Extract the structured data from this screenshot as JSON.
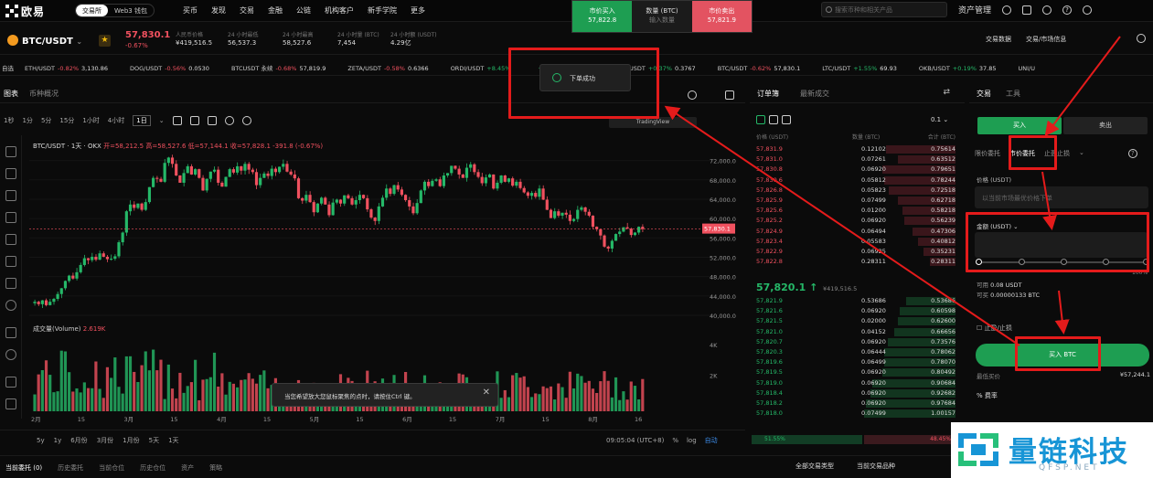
{
  "brand": {
    "name": "欧易",
    "mode_tabs": [
      "交易所",
      "Web3 钱包"
    ]
  },
  "nav": [
    "买币",
    "发现",
    "交易",
    "金融",
    "公链",
    "机构客户",
    "新手学院",
    "更多"
  ],
  "search": {
    "placeholder": "搜索币种和相关产品"
  },
  "top_right": {
    "asset_label": "资产管理"
  },
  "quick_order": {
    "buy": {
      "label": "市价买入",
      "value": "57,822.8"
    },
    "mid": {
      "label": "数量 (BTC)",
      "value": "输入数量"
    },
    "sell": {
      "label": "市价卖出",
      "value": "57,821.9"
    }
  },
  "pair": {
    "symbol": "BTC/USDT",
    "last": "57,830.1",
    "change": "-0.67%"
  },
  "stats": [
    {
      "label": "人民币价格",
      "value": "¥419,516.5"
    },
    {
      "label": "24 小时最低",
      "value": "56,537.3"
    },
    {
      "label": "24 小时最高",
      "value": "58,527.6"
    },
    {
      "label": "24 小时量 (BTC)",
      "value": "7,454"
    },
    {
      "label": "24 小时额 (USDT)",
      "value": "4.29亿"
    }
  ],
  "top_tools": [
    "交易数据",
    "交易/市场信息"
  ],
  "strip": [
    {
      "name": "ETH/USDT",
      "chg": "-0.82%",
      "price": "3,130.86",
      "dir": "dn"
    },
    {
      "name": "DOG/USDT",
      "chg": "-0.56%",
      "price": "0.0530",
      "dir": "dn"
    },
    {
      "name": "BTCUSDT 永续",
      "chg": "-0.68%",
      "price": "57,819.9",
      "dir": "dn"
    },
    {
      "name": "ZETA/USDT",
      "chg": "-0.58%",
      "price": "0.6366",
      "dir": "dn"
    },
    {
      "name": "ORDI/USDT",
      "chg": "+8.45%",
      "price": "",
      "dir": "up"
    },
    {
      "name": "",
      "chg": "+1.37%",
      "price": "0.00623",
      "dir": "up"
    },
    {
      "name": "LUNA/USDT",
      "chg": "+0.37%",
      "price": "0.3767",
      "dir": "up"
    },
    {
      "name": "BTC/USDT",
      "chg": "-0.62%",
      "price": "57,830.1",
      "dir": "dn"
    },
    {
      "name": "LTC/USDT",
      "chg": "+1.55%",
      "price": "69.93",
      "dir": "up"
    },
    {
      "name": "OKB/USDT",
      "chg": "+0.19%",
      "price": "37.85",
      "dir": "up"
    },
    {
      "name": "UNI/U",
      "chg": "",
      "price": "",
      "dir": "up"
    }
  ],
  "toast": {
    "text": "下单成功"
  },
  "chart_tabs": [
    "图表",
    "币种概况"
  ],
  "timeframes": [
    "1秒",
    "1分",
    "5分",
    "15分",
    "1小时",
    "4小时",
    "1日"
  ],
  "selected_tf": "1日",
  "tv_badge": "TradingView",
  "chart_title": "BTC/USDT · 1天 · OKX",
  "ohlc": "开=58,212.5 高=58,527.6 低=57,144.1 收=57,828.1 -391.8 (-0.67%)",
  "volume_title": {
    "label": "成交量(Volume)",
    "value": "2.619K"
  },
  "tooltip": {
    "text": "当您希望放大您鼠标聚焦的点时，请按住Ctrl 键。",
    "close": "✕"
  },
  "axis_bottom": {
    "ranges": [
      "5y",
      "1y",
      "6月份",
      "3月份",
      "1月份",
      "5天",
      "1天"
    ],
    "time": "09:05:04 (UTC+8)",
    "pct": "%",
    "log": "log",
    "auto": "自动"
  },
  "chart_data": {
    "type": "candlestick",
    "x_ticks": [
      "2月",
      "15",
      "3月",
      "15",
      "4月",
      "15",
      "5月",
      "15",
      "6月",
      "15",
      "7月",
      "15",
      "8月",
      "16"
    ],
    "y_ticks": [
      "72,000.0",
      "68,000.0",
      "64,000.0",
      "60,000.0",
      "56,000.0",
      "52,000.0",
      "48,000.0",
      "44,000.0",
      "40,000.0"
    ],
    "ylim": [
      40000,
      74000
    ],
    "last_price": "57,830.1",
    "vol_ticks": [
      "4K",
      "2K"
    ],
    "close": [
      42800,
      42300,
      43100,
      42100,
      42800,
      43400,
      44400,
      45600,
      47100,
      48200,
      47600,
      48900,
      50400,
      51800,
      51400,
      52100,
      51500,
      52800,
      52100,
      51600,
      51700,
      52200,
      55100,
      57100,
      61500,
      62900,
      62200,
      63100,
      61800,
      63400,
      66500,
      68400,
      68200,
      67600,
      71500,
      72600,
      71300,
      68900,
      67400,
      69400,
      70800,
      69100,
      70200,
      68400,
      65800,
      68200,
      69700,
      70100,
      67400,
      66600,
      68600,
      70200,
      69500,
      70800,
      69900,
      71300,
      70100,
      69600,
      66900,
      68400,
      69300,
      68800,
      70300,
      69600,
      70700,
      71300,
      69700,
      69100,
      68300,
      64200,
      63700,
      64900,
      63400,
      61300,
      63100,
      64300,
      62900,
      60700,
      63300,
      63900,
      63100,
      64800,
      64200,
      62900,
      63800,
      64900,
      64200,
      61900,
      60200,
      59500,
      62500,
      64300,
      66200,
      65100,
      66900,
      66000,
      64900,
      63800,
      62500,
      61100,
      63200,
      65800,
      67600,
      66700,
      67800,
      68100,
      66700,
      68900,
      69400,
      70900,
      70300,
      69100,
      68400,
      70500,
      71200,
      69600,
      68600,
      67300,
      68500,
      69100,
      66200,
      67400,
      68900,
      67600,
      68300,
      66800,
      67600,
      66300,
      65400,
      64700,
      65300,
      64500,
      66200,
      63900,
      61800,
      60100,
      61500,
      60600,
      61200,
      60800,
      59500,
      59900,
      61800,
      62300,
      61400,
      60600,
      58300,
      57800,
      56500,
      54200,
      53800,
      55400,
      56800,
      57300,
      58200,
      57900,
      56600,
      57100,
      58300,
      57830
    ],
    "volume_max": 5000
  },
  "orderbook": {
    "tabs": [
      "订单簿",
      "最新成交"
    ],
    "tick": "0.1",
    "cols": [
      "价格 (USDT)",
      "数量 (BTC)",
      "合计 (BTC)"
    ],
    "asks": [
      [
        "57,831.9",
        "0.12102",
        "0.75614"
      ],
      [
        "57,831.0",
        "0.07261",
        "0.63512"
      ],
      [
        "57,830.8",
        "0.06920",
        "0.79651"
      ],
      [
        "57,830.6",
        "0.05812",
        "0.78244"
      ],
      [
        "57,826.8",
        "0.05823",
        "0.72518"
      ],
      [
        "57,825.9",
        "0.07499",
        "0.62718"
      ],
      [
        "57,825.6",
        "0.01200",
        "0.58218"
      ],
      [
        "57,825.2",
        "0.06920",
        "0.56239"
      ],
      [
        "57,824.9",
        "0.06494",
        "0.47306"
      ],
      [
        "57,823.4",
        "0.05583",
        "0.40812"
      ],
      [
        "57,822.9",
        "0.06925",
        "0.35231"
      ],
      [
        "57,822.8",
        "0.28311",
        "0.28311"
      ]
    ],
    "mid_price": "57,820.1",
    "mid_cny": "¥419,516.5",
    "bids": [
      [
        "57,821.9",
        "0.53686",
        "0.53686"
      ],
      [
        "57,821.6",
        "0.06920",
        "0.60598"
      ],
      [
        "57,821.5",
        "0.02000",
        "0.62600"
      ],
      [
        "57,821.0",
        "0.04152",
        "0.66656"
      ],
      [
        "57,820.7",
        "0.06920",
        "0.73576"
      ],
      [
        "57,820.3",
        "0.06444",
        "0.78062"
      ],
      [
        "57,819.6",
        "0.06499",
        "0.78070"
      ],
      [
        "57,819.5",
        "0.06920",
        "0.80492"
      ],
      [
        "57,819.0",
        "0.06920",
        "0.90684"
      ],
      [
        "57,818.4",
        "0.06920",
        "0.92682"
      ],
      [
        "57,818.2",
        "0.06920",
        "0.97684"
      ],
      [
        "57,818.0",
        "0.07499",
        "1.00157"
      ]
    ],
    "buy_ratio": "51.55%",
    "sell_ratio": "48.45%"
  },
  "trade": {
    "tabs": [
      "交易",
      "工具"
    ],
    "buy": "买入",
    "sell": "卖出",
    "types": [
      "限价委托",
      "市价委托",
      "止盈止损"
    ],
    "selected_type": "市价委托",
    "price_label": "价格 (USDT)",
    "price_placeholder": "以当前市场最优价格下单",
    "amount_label": "金额 (USDT)",
    "available_label": "可用",
    "available": "0.08 USDT",
    "can_buy_label": "可买",
    "can_buy": "0.00000133 BTC",
    "slider_max": "100%",
    "tpsl": "止盈/止损",
    "buy_button": "买入 BTC",
    "fee_label": "最低买价",
    "fee_value": "¥57,244.1",
    "ratio": "% 费率"
  },
  "bottom_tabs": [
    "当前委托 (0)",
    "历史委托",
    "当前仓位",
    "历史仓位",
    "资产",
    "策略"
  ],
  "bottom_right": [
    "全部交易类型",
    "当前交易品种"
  ],
  "watermark": {
    "name": "量链科技",
    "domain": "QFSP.NET"
  },
  "colors": {
    "up": "#25b868",
    "down": "#f0515f",
    "accent": "#1e9e52",
    "annotation": "#e41b1b",
    "watermark": "#1795d6"
  }
}
